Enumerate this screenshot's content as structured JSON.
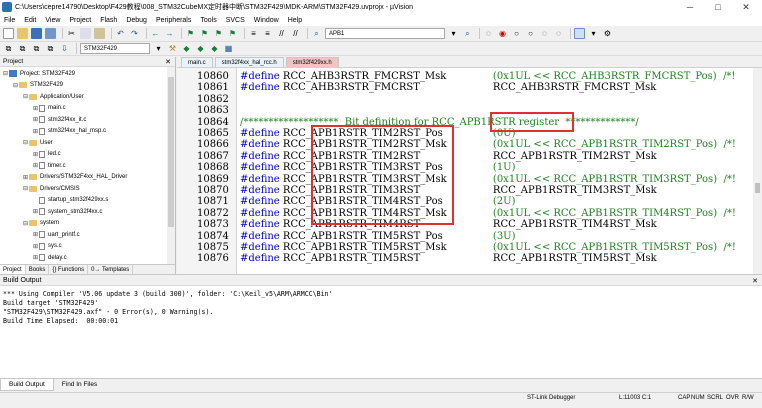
{
  "window": {
    "title": "C:\\Users\\cepre14790\\Desktop\\F429教程\\008_STM32CubeMX定时器中断\\STM32F429\\MDK-ARM\\STM32F429.uvprojx - µVision",
    "minimize": "─",
    "maximize": "□",
    "close": "✕"
  },
  "menu": [
    "File",
    "Edit",
    "View",
    "Project",
    "Flash",
    "Debug",
    "Peripherals",
    "Tools",
    "SVCS",
    "Window",
    "Help"
  ],
  "toolbar": {
    "search_combo": "APB1",
    "target_combo": "STM32F429"
  },
  "project_panel": {
    "title": "Project",
    "pin": "✕",
    "tree": [
      {
        "label": "Project: STM32F429",
        "type": "project",
        "indent": 0,
        "toggle": "⊟"
      },
      {
        "label": "STM32F429",
        "type": "folder",
        "indent": 1,
        "toggle": "⊟"
      },
      {
        "label": "Application/User",
        "type": "folder",
        "indent": 2,
        "toggle": "⊟"
      },
      {
        "label": "main.c",
        "type": "file",
        "indent": 3,
        "toggle": "⊞"
      },
      {
        "label": "stm32f4xx_it.c",
        "type": "file",
        "indent": 3,
        "toggle": "⊞"
      },
      {
        "label": "stm32f4xx_hal_msp.c",
        "type": "file",
        "indent": 3,
        "toggle": "⊞"
      },
      {
        "label": "User",
        "type": "folder",
        "indent": 2,
        "toggle": "⊟"
      },
      {
        "label": "led.c",
        "type": "file",
        "indent": 3,
        "toggle": "⊞"
      },
      {
        "label": "timer.c",
        "type": "file",
        "indent": 3,
        "toggle": "⊞"
      },
      {
        "label": "Drivers/STM32F4xx_HAL_Driver",
        "type": "folder",
        "indent": 2,
        "toggle": "⊞"
      },
      {
        "label": "Drivers/CMSIS",
        "type": "folder",
        "indent": 2,
        "toggle": "⊟"
      },
      {
        "label": "startup_stm32f429xx.s",
        "type": "file",
        "indent": 3,
        "toggle": ""
      },
      {
        "label": "system_stm32f4xx.c",
        "type": "file",
        "indent": 3,
        "toggle": "⊞"
      },
      {
        "label": "system",
        "type": "folder",
        "indent": 2,
        "toggle": "⊟"
      },
      {
        "label": "uart_printf.c",
        "type": "file",
        "indent": 3,
        "toggle": "⊞"
      },
      {
        "label": "sys.c",
        "type": "file",
        "indent": 3,
        "toggle": "⊞"
      },
      {
        "label": "delay.c",
        "type": "file",
        "indent": 3,
        "toggle": "⊞"
      }
    ],
    "tabs": [
      "Project",
      "Books",
      "{} Functions",
      "0→ Templates"
    ]
  },
  "editor": {
    "tabs": [
      {
        "label": "main.c",
        "active": false
      },
      {
        "label": "stm32f4xx_hal_rcc.h",
        "active": false
      },
      {
        "label": "stm32f429xx.h",
        "active": true
      }
    ],
    "lines": [
      {
        "num": "10860",
        "kw": "#define",
        "name": "RCC_AHB3RSTR_FMCRST_Msk",
        "value": "(0x1UL << RCC_AHB3RSTR_FMCRST_Pos)",
        "comment": "/*!"
      },
      {
        "num": "10861",
        "kw": "#define",
        "name": "RCC_AHB3RSTR_FMCRST",
        "value": "RCC_AHB3RSTR_FMCRST_Msk",
        "comment": ""
      },
      {
        "num": "10862",
        "kw": "",
        "name": "",
        "value": "",
        "comment": ""
      },
      {
        "num": "10863",
        "kw": "",
        "name": "",
        "value": "",
        "comment": ""
      },
      {
        "num": "10864",
        "kw": "",
        "name": "",
        "value": "",
        "comment": "/*******************  Bit definition for RCC_APB1RSTR register  **************/"
      },
      {
        "num": "10865",
        "kw": "#define",
        "name": "RCC_APB1RSTR_TIM2RST_Pos",
        "value": "(0U)",
        "comment": ""
      },
      {
        "num": "10866",
        "kw": "#define",
        "name": "RCC_APB1RSTR_TIM2RST_Msk",
        "value": "(0x1UL << RCC_APB1RSTR_TIM2RST_Pos)",
        "comment": "/*!"
      },
      {
        "num": "10867",
        "kw": "#define",
        "name": "RCC_APB1RSTR_TIM2RST",
        "value": "RCC_APB1RSTR_TIM2RST_Msk",
        "comment": ""
      },
      {
        "num": "10868",
        "kw": "#define",
        "name": "RCC_APB1RSTR_TIM3RST_Pos",
        "value": "(1U)",
        "comment": ""
      },
      {
        "num": "10869",
        "kw": "#define",
        "name": "RCC_APB1RSTR_TIM3RST_Msk",
        "value": "(0x1UL << RCC_APB1RSTR_TIM3RST_Pos)",
        "comment": "/*!"
      },
      {
        "num": "10870",
        "kw": "#define",
        "name": "RCC_APB1RSTR_TIM3RST",
        "value": "RCC_APB1RSTR_TIM3RST_Msk",
        "comment": ""
      },
      {
        "num": "10871",
        "kw": "#define",
        "name": "RCC_APB1RSTR_TIM4RST_Pos",
        "value": "(2U)",
        "comment": ""
      },
      {
        "num": "10872",
        "kw": "#define",
        "name": "RCC_APB1RSTR_TIM4RST_Msk",
        "value": "(0x1UL << RCC_APB1RSTR_TIM4RST_Pos)",
        "comment": "/*!"
      },
      {
        "num": "10873",
        "kw": "#define",
        "name": "RCC_APB1RSTR_TIM4RST",
        "value": "RCC_APB1RSTR_TIM4RST_Msk",
        "comment": ""
      },
      {
        "num": "10874",
        "kw": "#define",
        "name": "RCC_APB1RSTR_TIM5RST_Pos",
        "value": "(3U)",
        "comment": ""
      },
      {
        "num": "10875",
        "kw": "#define",
        "name": "RCC_APB1RSTR_TIM5RST_Msk",
        "value": "(0x1UL << RCC_APB1RSTR_TIM5RST_Pos)",
        "comment": "/*!"
      },
      {
        "num": "10876",
        "kw": "#define",
        "name": "RCC_APB1RSTR_TIM5RST",
        "value": "RCC_APB1RSTR_TIM5RST_Msk",
        "comment": ""
      }
    ]
  },
  "build_output": {
    "title": "Build Output",
    "pin": "✕",
    "lines": [
      "*** Using Compiler 'V5.06 update 3 (build 300)', folder: 'C:\\Keil_v5\\ARM\\ARMCC\\Bin'",
      "Build target 'STM32F429'",
      "\"STM32F429\\STM32F429.axf\" - 0 Error(s), 0 Warning(s).",
      "Build Time Elapsed:  00:00:01"
    ],
    "tabs": [
      "Build Output",
      "Find In Files"
    ]
  },
  "status": {
    "debugger": "ST-Link Debugger",
    "position": "L:11003 C:1",
    "caps": "CAP",
    "num": "NUM",
    "scrl": "SCRL",
    "ovr": "OVR",
    "rw": "R/W"
  },
  "colors": {
    "keyword": "#0000c8",
    "comment": "#208020",
    "highlight_box": "#e03030",
    "active_tab": "#f4c2c2"
  }
}
